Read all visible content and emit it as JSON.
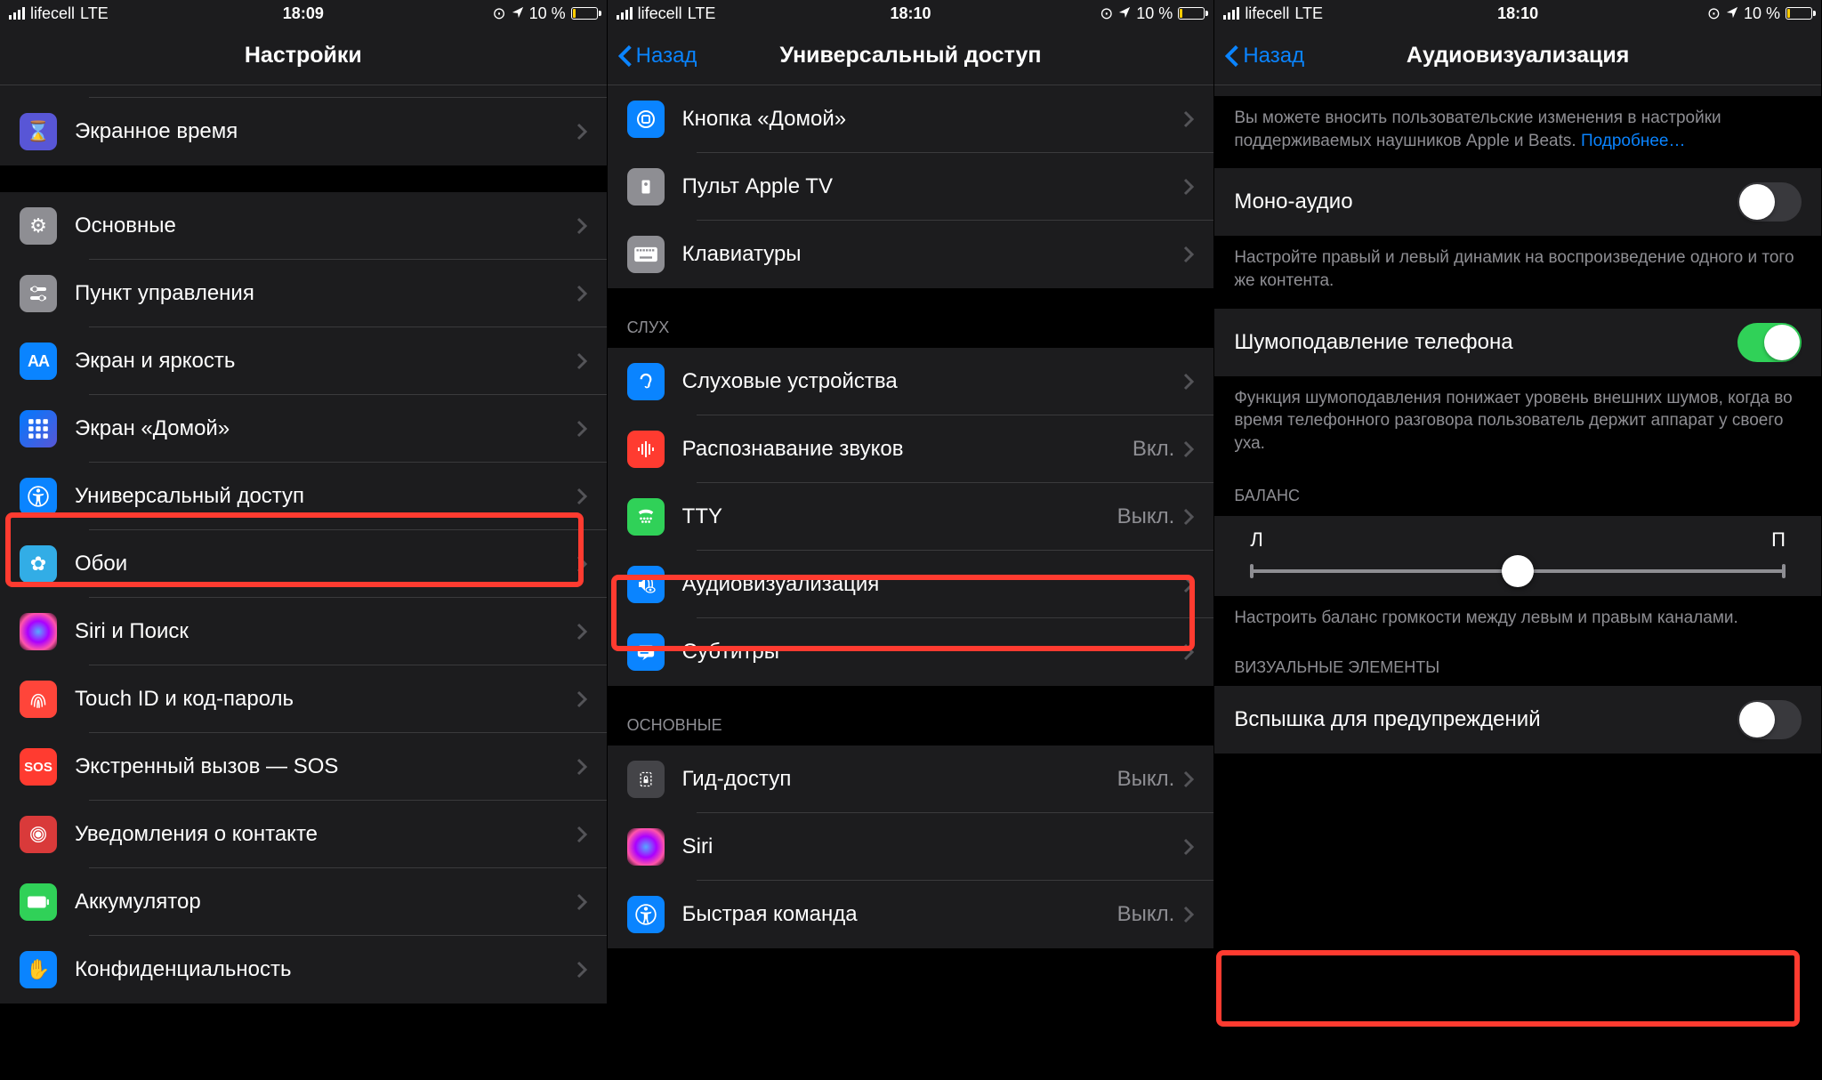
{
  "status": {
    "carrier": "lifecell",
    "network": "LTE",
    "battery_text": "10 %"
  },
  "screen1": {
    "time": "18:09",
    "title": "Настройки",
    "rows": {
      "screentime": "Экранное время",
      "general": "Основные",
      "control": "Пункт управления",
      "display": "Экран и яркость",
      "home": "Экран «Домой»",
      "accessibility": "Универсальный доступ",
      "wallpaper": "Обои",
      "siri": "Siri и Поиск",
      "touchid": "Touch ID и код-пароль",
      "sos": "Экстренный вызов — SOS",
      "exposure": "Уведомления о контакте",
      "battery": "Аккумулятор",
      "privacy": "Конфиденциальность"
    }
  },
  "screen2": {
    "time": "18:10",
    "back": "Назад",
    "title": "Универсальный доступ",
    "rows": {
      "home": "Кнопка «Домой»",
      "appletv": "Пульт Apple TV",
      "keyboards": "Клавиатуры",
      "hearing_header": "СЛУХ",
      "hearing_devices": "Слуховые устройства",
      "sound_recog": "Распознавание звуков",
      "sound_recog_val": "Вкл.",
      "tty": "TTY",
      "tty_val": "Выкл.",
      "audiovisual": "Аудиовизуализация",
      "subtitles": "Субтитры",
      "general_header": "ОСНОВНЫЕ",
      "guided": "Гид-доступ",
      "guided_val": "Выкл.",
      "siri": "Siri",
      "shortcut": "Быстрая команда",
      "shortcut_val": "Выкл."
    }
  },
  "screen3": {
    "time": "18:10",
    "back": "Назад",
    "title": "Аудиовизуализация",
    "lead_desc": "Вы можете вносить пользовательские изменения в настройки поддерживаемых наушников Apple и Beats. ",
    "lead_link": "Подробнее…",
    "mono": "Моно-аудио",
    "mono_desc": "Настройте правый и левый динамик на воспроизведение одного и того же контента.",
    "noise": "Шумоподавление телефона",
    "noise_desc": "Функция шумоподавления понижает уровень внешних шумов, когда во время телефонного разговора пользователь держит аппарат у своего уха.",
    "balance_header": "БАЛАНС",
    "balance_left": "Л",
    "balance_right": "П",
    "balance_desc": "Настроить баланс громкости между левым и правым каналами.",
    "visual_header": "ВИЗУАЛЬНЫЕ ЭЛЕМЕНТЫ",
    "flash": "Вспышка для предупреждений"
  }
}
